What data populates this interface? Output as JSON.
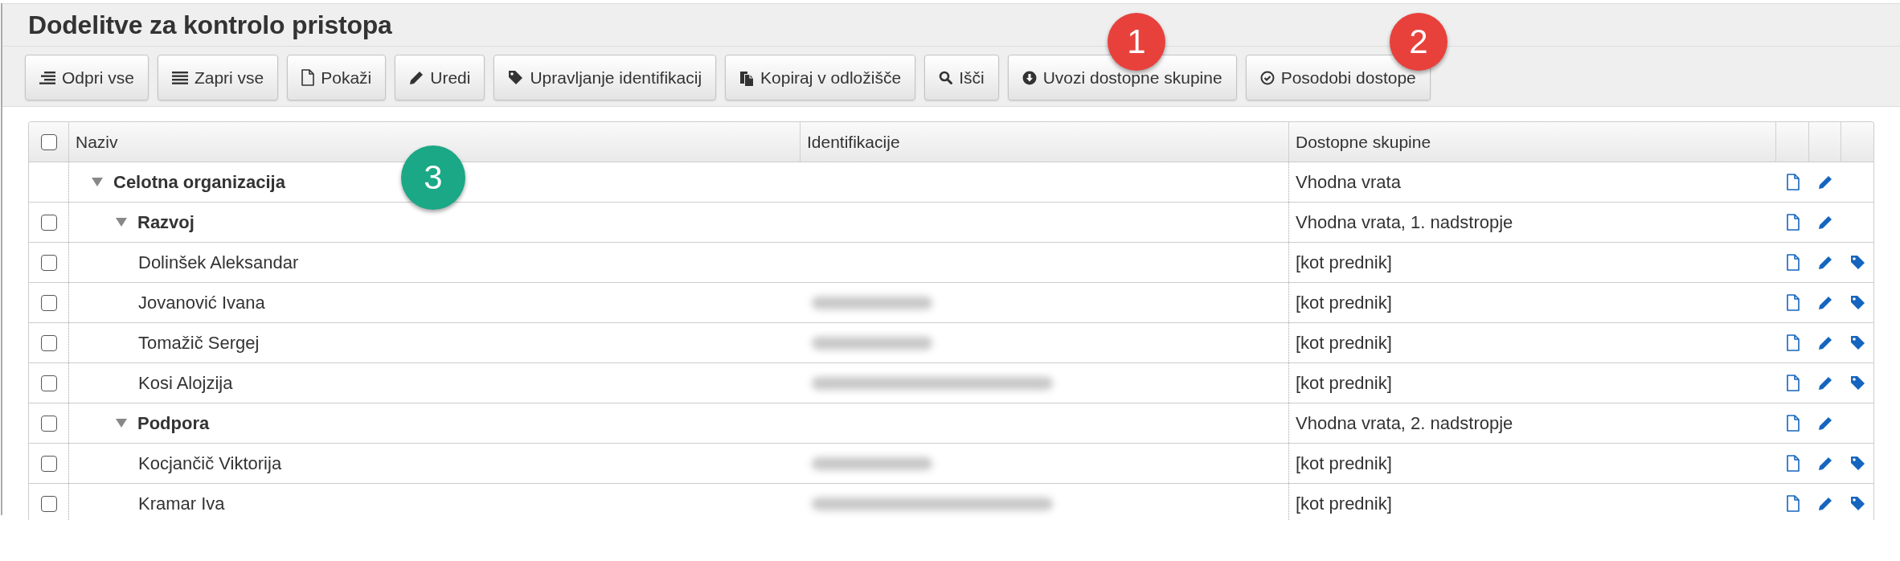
{
  "title": "Dodelitve za kontrolo pristopa",
  "toolbar": {
    "buttons": [
      {
        "label": "Odpri vse"
      },
      {
        "label": "Zapri vse"
      },
      {
        "label": "Pokaži"
      },
      {
        "label": "Uredi"
      },
      {
        "label": "Upravljanje identifikacij"
      },
      {
        "label": "Kopiraj v odložišče"
      },
      {
        "label": "Išči"
      },
      {
        "label": "Uvozi dostopne skupine"
      },
      {
        "label": "Posodobi dostope"
      }
    ]
  },
  "callouts": [
    {
      "label": "1",
      "color": "#e8413c"
    },
    {
      "label": "2",
      "color": "#e8413c"
    },
    {
      "label": "3",
      "color": "#1aa886"
    }
  ],
  "table": {
    "header_checkbox": {
      "checked": false
    },
    "columns": [
      "Naziv",
      "Identifikacije",
      "Dostopne skupine"
    ],
    "rows": [
      {
        "kind": "group",
        "name": "Celotna organizacija",
        "expanded": true,
        "access_groups": "Vhodna vrata",
        "children": [
          {
            "kind": "group",
            "checked": false,
            "name": "Razvoj",
            "expanded": true,
            "access_groups": "Vhodna vrata, 1. nadstropje",
            "children": [
              {
                "kind": "person",
                "checked": false,
                "name": "Dolinšek Aleksandar",
                "access_groups": "[kot prednik]"
              },
              {
                "kind": "person",
                "checked": false,
                "name": "Jovanović Ivana",
                "identifiers_blurred": true,
                "identifiers_long": false,
                "access_groups": "[kot prednik]"
              },
              {
                "kind": "person",
                "checked": false,
                "name": "Tomažič Sergej",
                "identifiers_blurred": true,
                "identifiers_long": false,
                "access_groups": "[kot prednik]"
              },
              {
                "kind": "person",
                "checked": false,
                "name": "Kosi Alojzija",
                "identifiers_blurred": true,
                "identifiers_long": true,
                "access_groups": "[kot prednik]"
              }
            ]
          },
          {
            "kind": "group",
            "checked": false,
            "name": "Podpora",
            "expanded": true,
            "access_groups": "Vhodna vrata, 2. nadstropje",
            "children": [
              {
                "kind": "person",
                "checked": false,
                "name": "Kocjančič Viktorija",
                "identifiers_blurred": true,
                "identifiers_long": false,
                "access_groups": "[kot prednik]"
              },
              {
                "kind": "person",
                "checked": false,
                "name": "Kramar Iva",
                "identifiers_blurred": true,
                "identifiers_long": true,
                "access_groups": "[kot prednik]"
              }
            ]
          }
        ]
      }
    ]
  }
}
